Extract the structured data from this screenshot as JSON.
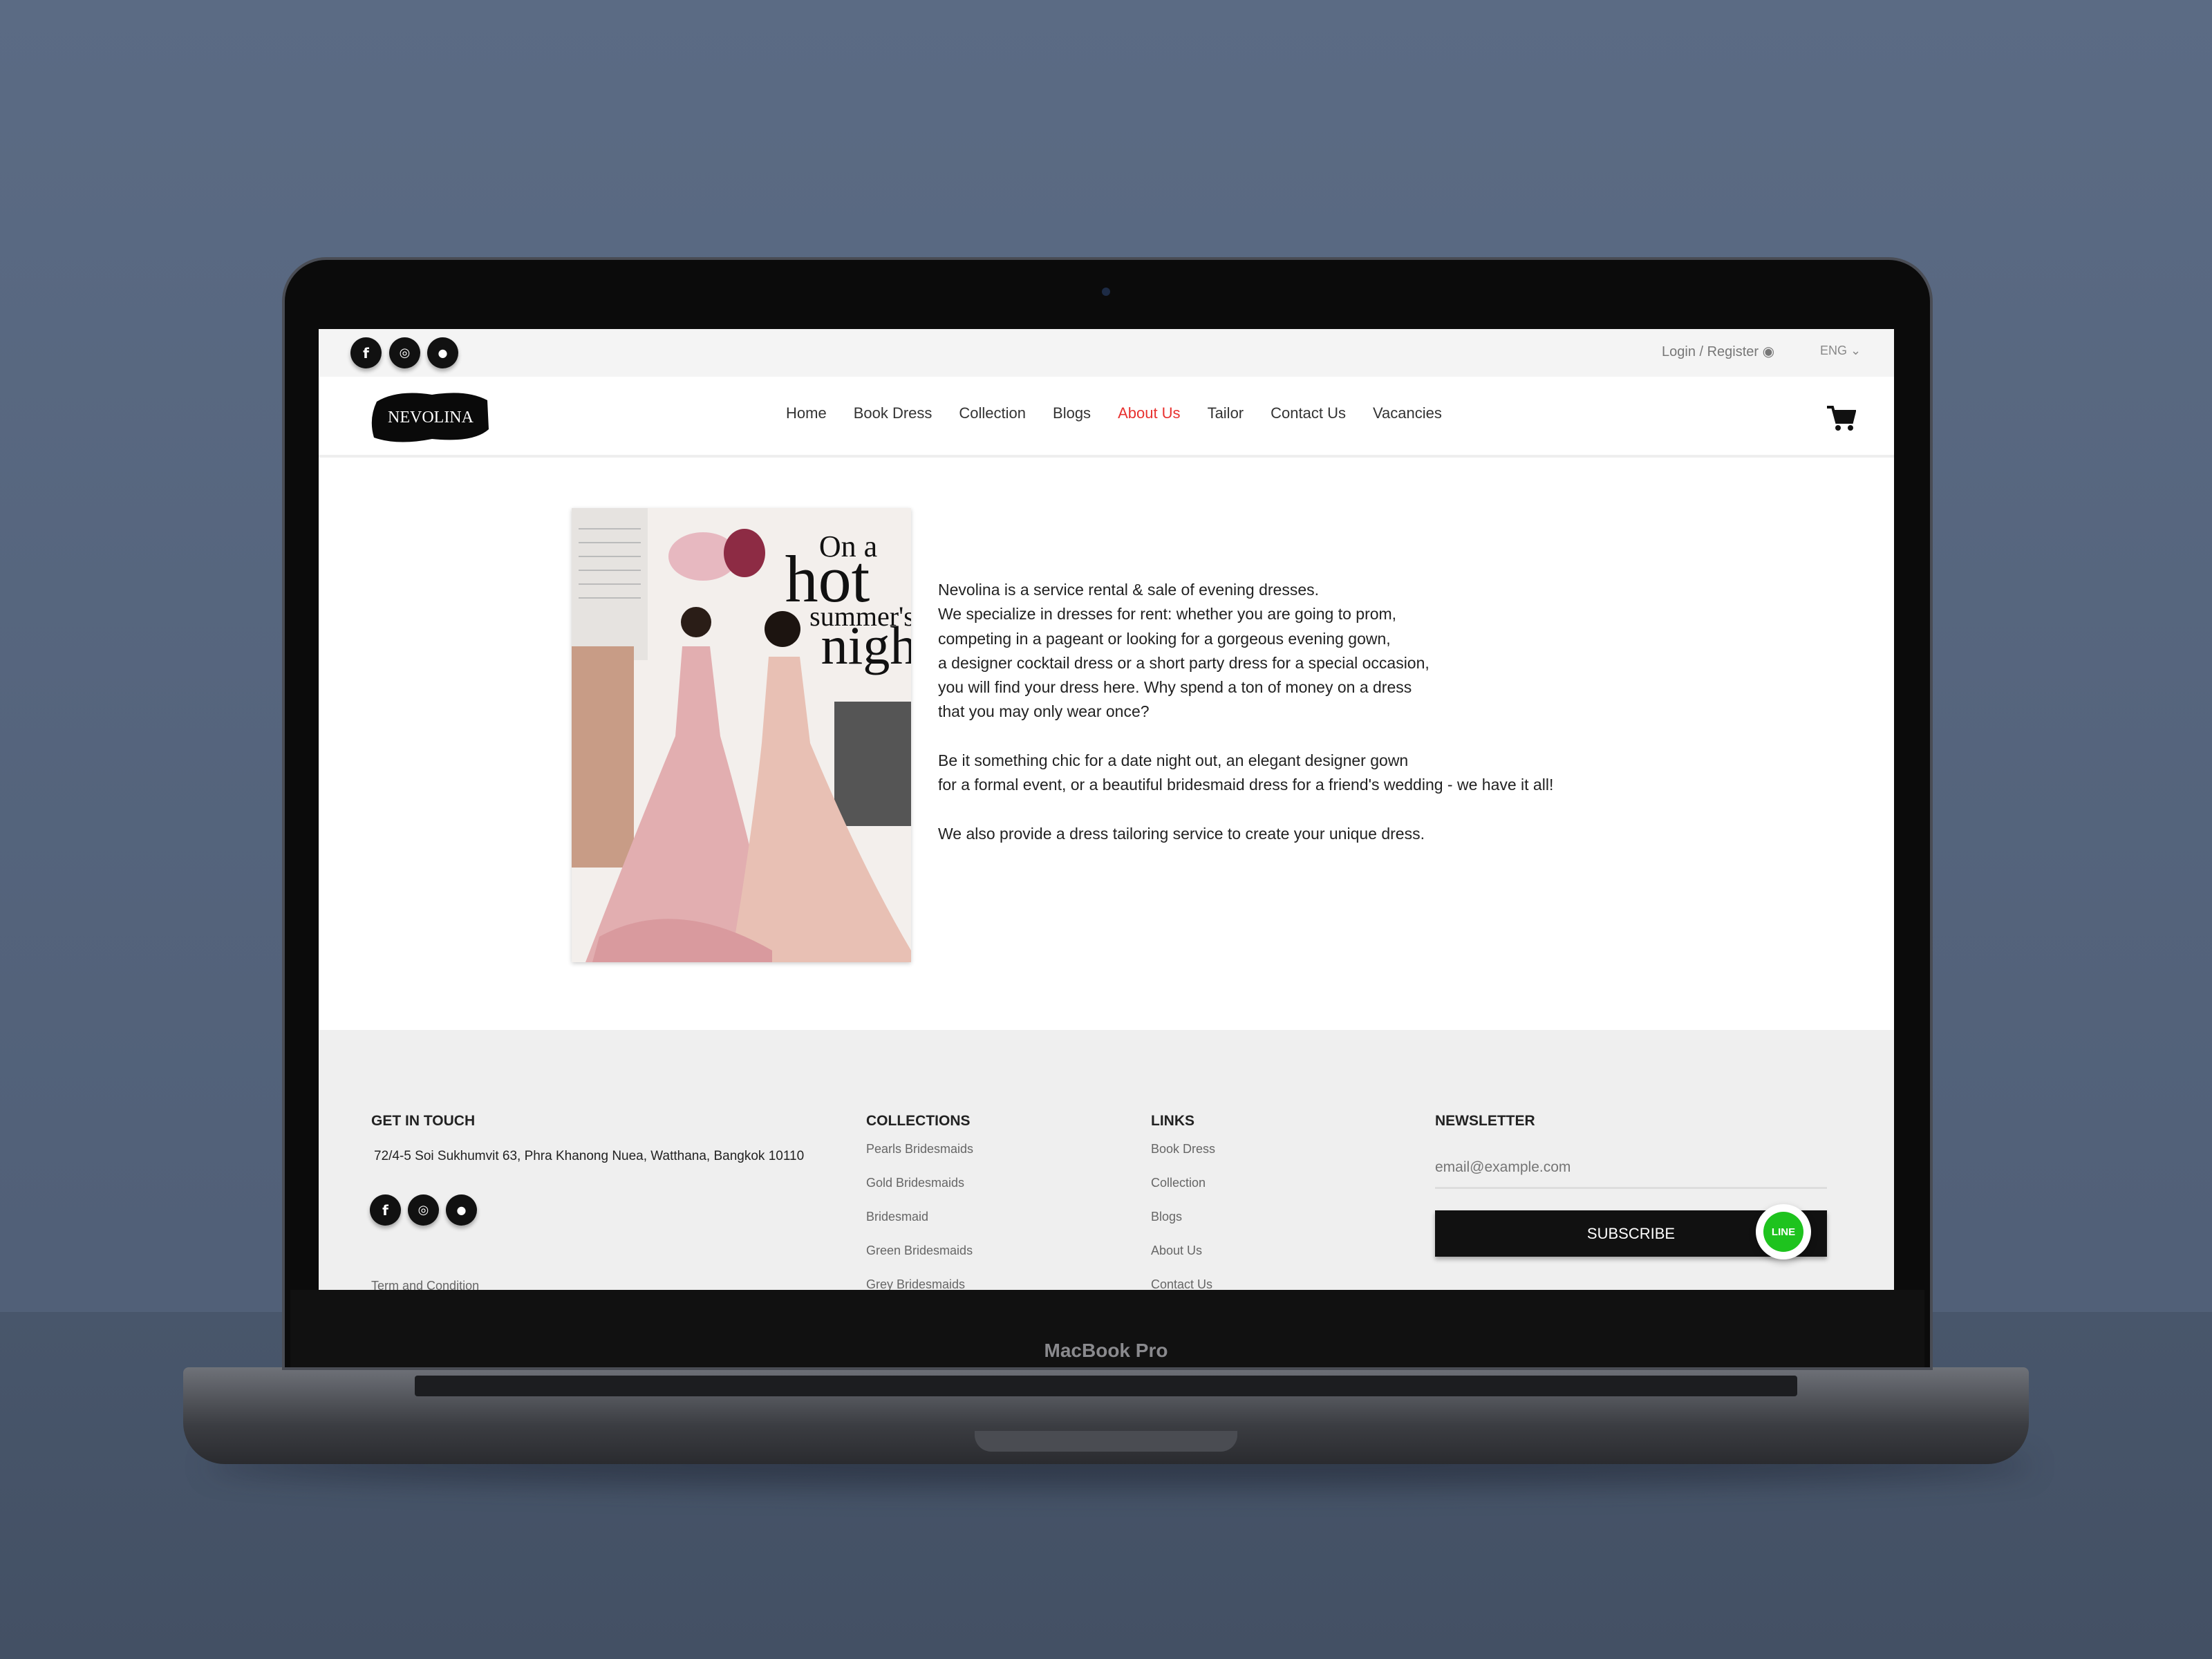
{
  "device": {
    "label": "MacBook Pro"
  },
  "topbar": {
    "social": [
      {
        "icon": "facebook-icon",
        "glyph": "f"
      },
      {
        "icon": "instagram-icon",
        "glyph": "◎"
      },
      {
        "icon": "line-icon",
        "glyph": "●"
      }
    ],
    "login": "Login / Register",
    "lang": "ENG ⌄"
  },
  "nav": {
    "logo": "NEVOLINA",
    "items": [
      "Home",
      "Book Dress",
      "Collection",
      "Blogs",
      "About Us",
      "Tailor",
      "Contact Us",
      "Vacancies"
    ],
    "active": "About Us"
  },
  "about": {
    "image_text": [
      "On a",
      "hot",
      "summer's",
      "nigh"
    ],
    "p1": [
      "Nevolina is a service rental & sale of evening dresses.",
      "We specialize in dresses for rent: whether you are going to prom,",
      "competing in a pageant or looking for a gorgeous evening gown,",
      "a designer cocktail dress or a short party dress for a special occasion,",
      "you will find your dress here. Why spend a ton of money on a dress",
      "that you may only wear once?"
    ],
    "p2": [
      "Be it something chic for a date night out, an elegant designer gown",
      "for a formal event, or a beautiful bridesmaid dress for a friend's wedding - we have it all!"
    ],
    "p3": "We also provide a dress tailoring service to create your unique dress."
  },
  "footer": {
    "get_in_touch": {
      "title": "GET IN TOUCH",
      "address": "72/4-5 Soi Sukhumvit 63, Phra Khanong Nuea, Watthana, Bangkok 10110",
      "term": "Term and Condition"
    },
    "collections": {
      "title": "COLLECTIONS",
      "items": [
        "Pearls Bridesmaids",
        "Gold Bridesmaids",
        "Bridesmaid",
        "Green Bridesmaids",
        "Grey Bridesmaids"
      ]
    },
    "links": {
      "title": "LINKS",
      "items": [
        "Book Dress",
        "Collection",
        "Blogs",
        "About Us",
        "Contact Us"
      ]
    },
    "newsletter": {
      "title": "NEWSLETTER",
      "placeholder": "email@example.com",
      "button": "SUBSCRIBE"
    },
    "line_badge": "LINE"
  },
  "colors": {
    "accent": "#e8312f",
    "line_green": "#1ec31e"
  }
}
